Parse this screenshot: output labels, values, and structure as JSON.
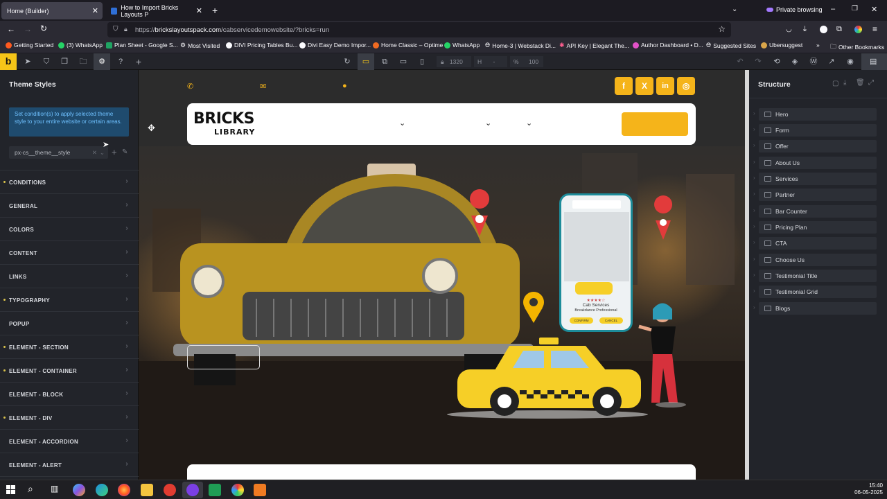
{
  "browser": {
    "tabs": [
      {
        "title": "Home (Builder)",
        "active": true
      },
      {
        "title": "How to Import Bricks Layouts P",
        "active": false
      }
    ],
    "private_label": "Private browsing",
    "url_prefix": "https://",
    "url_domain": "brickslayoutspack.com",
    "url_path": "/cabservicedemowebsite/?bricks=run"
  },
  "bookmarks": [
    "Getting Started",
    "(3) WhatsApp",
    "Plan Sheet - Google S...",
    "Most Visited",
    "DIVI Pricing Tables Bu...",
    "Divi Easy Demo Impor...",
    "Home Classic – Optime",
    "WhatsApp",
    "Home-3 | Webstack Di...",
    "API Key | Elegant The...",
    "Author Dashboard • D...",
    "Suggested Sites",
    "Ubersuggest",
    "Other Bookmarks"
  ],
  "builder_toolbar": {
    "logo": "b",
    "width_value": "1320",
    "height_placeholder": "-",
    "percent_value": "100",
    "width_prefix": "H",
    "percent_prefix": "%"
  },
  "left_panel": {
    "title": "Theme Styles",
    "notice": "Set condition(s) to apply selected theme style to your entire website or certain areas.",
    "style_select": "px-cs__theme__style",
    "sections": [
      {
        "label": "CONDITIONS",
        "dot": true
      },
      {
        "label": "GENERAL",
        "dot": false
      },
      {
        "label": "COLORS",
        "dot": false
      },
      {
        "label": "CONTENT",
        "dot": false
      },
      {
        "label": "LINKS",
        "dot": false
      },
      {
        "label": "TYPOGRAPHY",
        "dot": true
      },
      {
        "label": "POPUP",
        "dot": false
      },
      {
        "label": "ELEMENT - SECTION",
        "dot": true
      },
      {
        "label": "ELEMENT - CONTAINER",
        "dot": true
      },
      {
        "label": "ELEMENT - BLOCK",
        "dot": false
      },
      {
        "label": "ELEMENT - DIV",
        "dot": true
      },
      {
        "label": "ELEMENT - ACCORDION",
        "dot": false
      },
      {
        "label": "ELEMENT - ALERT",
        "dot": false
      }
    ]
  },
  "canvas": {
    "logo_line1": "BRICKS",
    "logo_line2": "LIBRARY",
    "phone_title": "Cab Services",
    "phone_subtitle": "Breakdance Professional",
    "phone_confirm": "CONFIRM",
    "phone_cancel": "CANCEL",
    "stars": "★★★★☆",
    "social": [
      "f",
      "X",
      "in",
      "◎"
    ],
    "colors": {
      "accent": "#f5b41a",
      "taxi": "#f6cf27",
      "pin": "#e23b3b"
    }
  },
  "right_panel": {
    "title": "Structure",
    "items": [
      "Hero",
      "Form",
      "Offer",
      "About Us",
      "Services",
      "Partner",
      "Bar Counter",
      "Pricing Plan",
      "CTA",
      "Choose Us",
      "Testimonial Title",
      "Testimonial Grid",
      "Blogs"
    ]
  },
  "taskbar": {
    "time": "15:40",
    "date": "06-05-2025"
  }
}
